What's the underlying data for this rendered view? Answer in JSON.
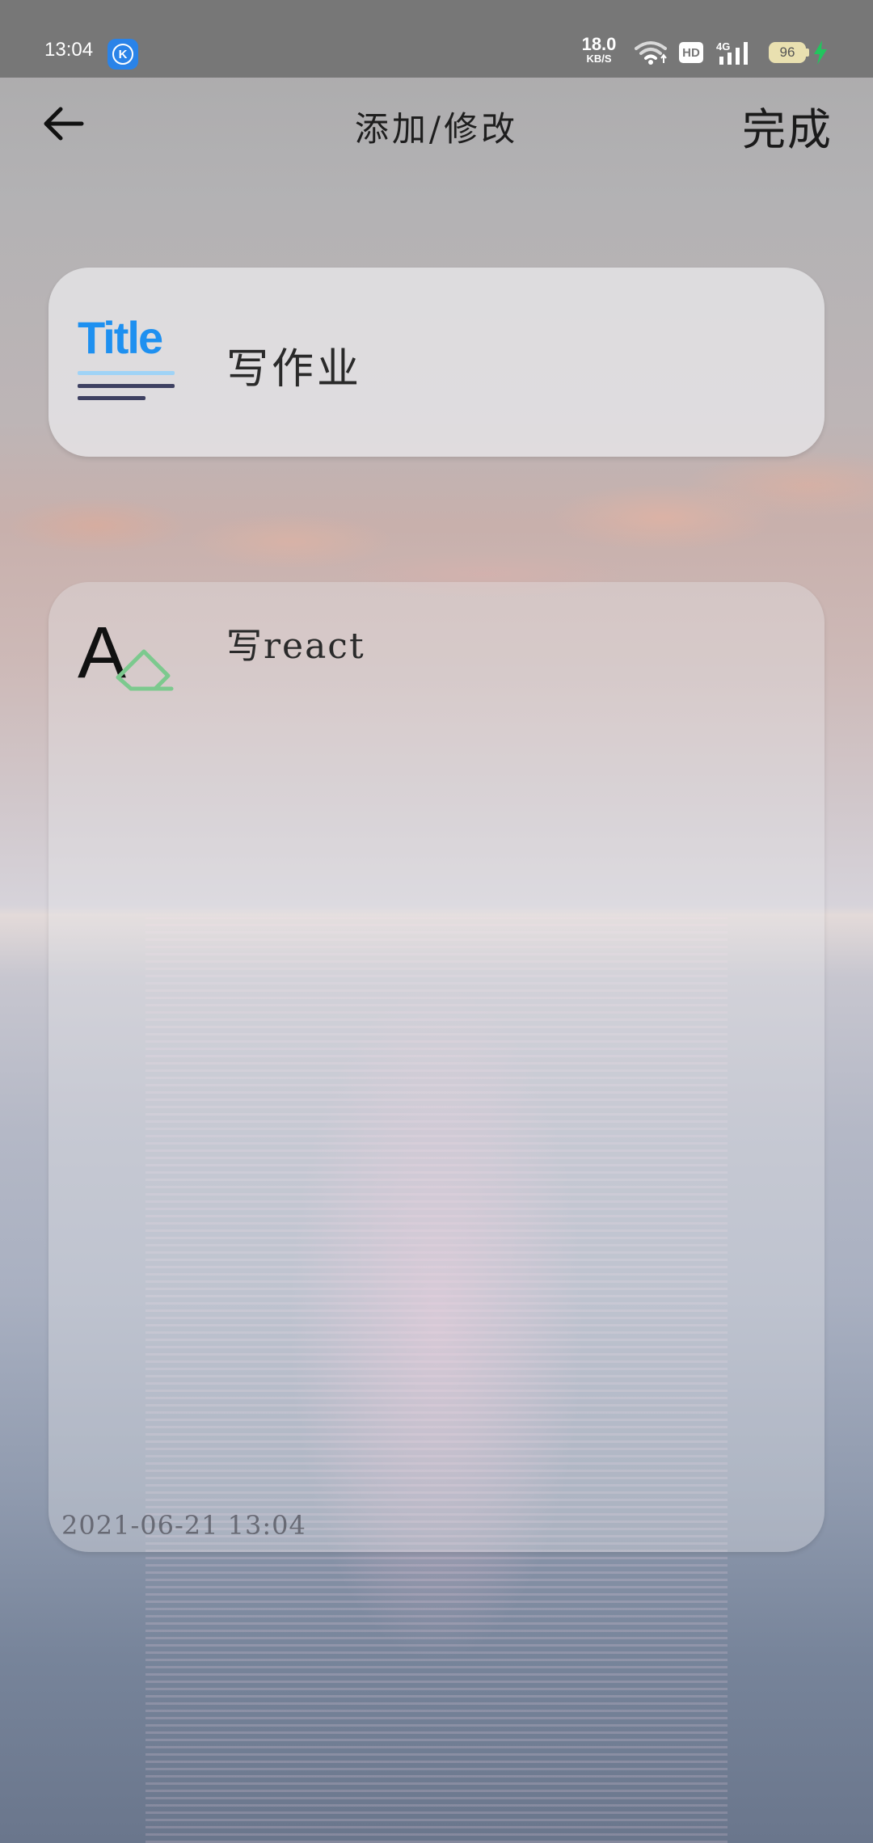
{
  "status_bar": {
    "time": "13:04",
    "app_badge": "K",
    "net_speed_value": "18.0",
    "net_speed_unit": "KB/S",
    "hd": "HD",
    "network": "4G",
    "battery": "96",
    "charging": true
  },
  "header": {
    "title": "添加/修改",
    "done_label": "完成",
    "back_icon": "arrow-left-icon"
  },
  "title_card": {
    "icon_word": "Title",
    "value": "写作业"
  },
  "content_card": {
    "icon_letter": "A",
    "value": "写react",
    "timestamp": "2021-06-21 13:04"
  },
  "colors": {
    "status_bar": "#777777",
    "title_icon_blue": "#1e90f0",
    "title_icon_light": "#9fd3f6",
    "title_icon_dark": "#3e4162",
    "eraser_green": "#7cc98e",
    "battery": "#e9e0b0",
    "bolt": "#22c55e"
  }
}
